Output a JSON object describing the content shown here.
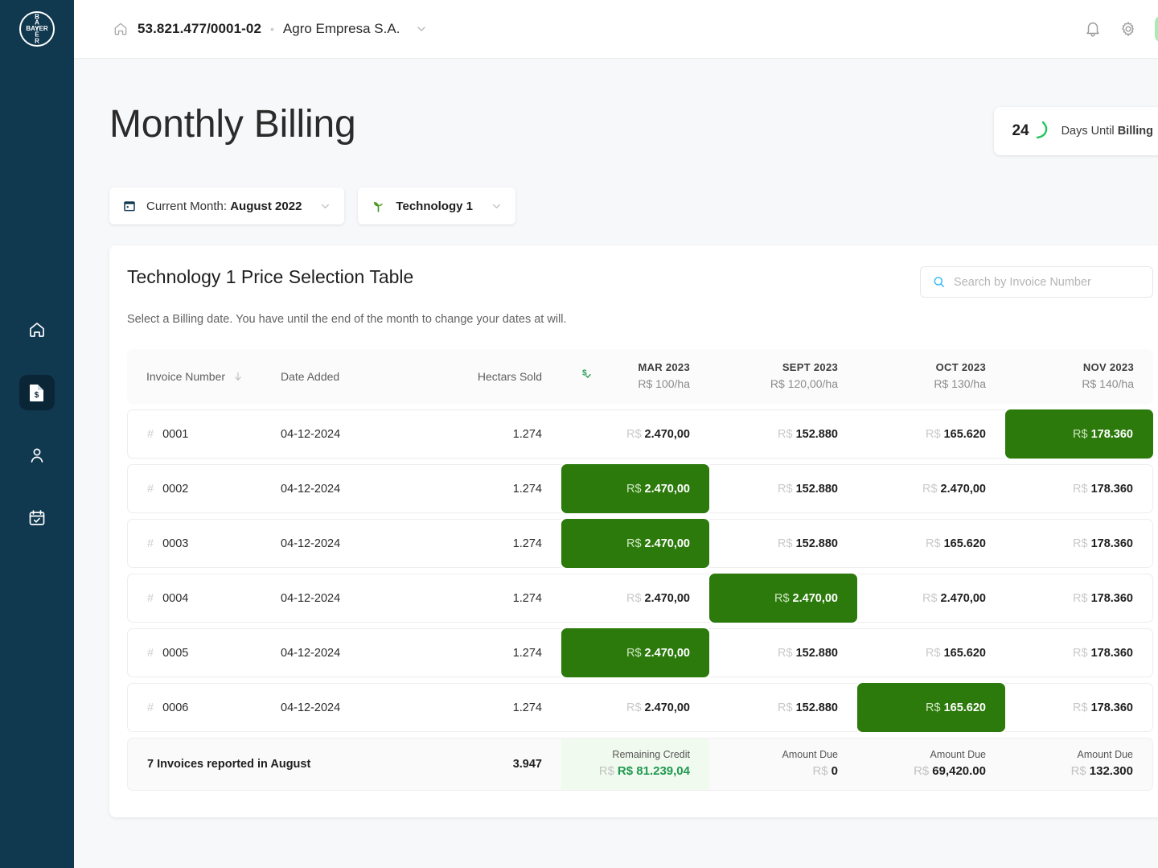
{
  "brand": {
    "logo_text": "BAYER",
    "sidebar_bg": "#10384f",
    "accent_green": "#2b7a0b",
    "light_green": "#f1faee"
  },
  "sidebar": {
    "items": [
      {
        "name": "home",
        "icon": "home-icon",
        "active": false
      },
      {
        "name": "billing",
        "icon": "invoice-dollar-icon",
        "active": true
      },
      {
        "name": "profile",
        "icon": "user-icon",
        "active": false
      },
      {
        "name": "calendar",
        "icon": "calendar-check-icon",
        "active": false
      }
    ]
  },
  "topbar": {
    "home_icon": "home-icon",
    "cnpj": "53.821.477/0001-02",
    "separator": "•",
    "company": "Agro Empresa S.A.",
    "chevron": "chevron-down-icon",
    "notifications_icon": "bell-icon",
    "settings_icon": "gear-icon",
    "avatar_label": "avatar"
  },
  "page": {
    "title": "Monthly Billing",
    "billing_badge": {
      "days": "24",
      "prefix": "Days Until ",
      "bold": "Billing"
    }
  },
  "filters": [
    {
      "icon": "calendar-icon",
      "prefix": "Current Month: ",
      "value": "August 2022",
      "chevron": "chevron-down-icon"
    },
    {
      "icon": "sprout-icon",
      "prefix": "",
      "value": "Technology 1",
      "chevron": "chevron-down-icon"
    }
  ],
  "card": {
    "title": "Technology 1 Price Selection Table",
    "subtitle": "Select a Billing date. You have until the end of the month to change your dates at will.",
    "search": {
      "placeholder": "Search by Invoice Number",
      "value": "",
      "icon": "search-icon"
    }
  },
  "table": {
    "headers": {
      "invoice": "Invoice Number",
      "sort_icon": "arrow-down-icon",
      "date": "Date Added",
      "hectars": "Hectars Sold",
      "dollar_check_icon": "dollar-check-icon"
    },
    "months": [
      {
        "label": "MAR 2023",
        "price": "R$ 100",
        "unit": "/ha",
        "highlight": true
      },
      {
        "label": "SEPT 2023",
        "price": "R$ 120,00",
        "unit": "/ha",
        "highlight": false
      },
      {
        "label": "OCT 2023",
        "price": "R$ 130",
        "unit": "/ha",
        "highlight": false
      },
      {
        "label": "NOV 2023",
        "price": "R$ 140",
        "unit": "/ha",
        "highlight": false
      }
    ],
    "hash": "#",
    "currency": "R$",
    "rows": [
      {
        "invoice": "0001",
        "date": "04-12-2024",
        "hectars": "1.274",
        "values": [
          "2.470,00",
          "152.880",
          "165.620",
          "178.360"
        ],
        "selected": 3
      },
      {
        "invoice": "0002",
        "date": "04-12-2024",
        "hectars": "1.274",
        "values": [
          "2.470,00",
          "152.880",
          "2.470,00",
          "178.360"
        ],
        "selected": 0
      },
      {
        "invoice": "0003",
        "date": "04-12-2024",
        "hectars": "1.274",
        "values": [
          "2.470,00",
          "152.880",
          "165.620",
          "178.360"
        ],
        "selected": 0
      },
      {
        "invoice": "0004",
        "date": "04-12-2024",
        "hectars": "1.274",
        "values": [
          "2.470,00",
          "2.470,00",
          "2.470,00",
          "178.360"
        ],
        "selected": 1
      },
      {
        "invoice": "0005",
        "date": "04-12-2024",
        "hectars": "1.274",
        "values": [
          "2.470,00",
          "152.880",
          "165.620",
          "178.360"
        ],
        "selected": 0
      },
      {
        "invoice": "0006",
        "date": "04-12-2024",
        "hectars": "1.274",
        "values": [
          "2.470,00",
          "152.880",
          "165.620",
          "178.360"
        ],
        "selected": 2
      }
    ],
    "footer": {
      "summary": "7 Invoices reported in August",
      "hectars_total": "3.947",
      "cells": [
        {
          "caption": "Remaining Credit",
          "currency": "R$",
          "amount": "R$ 81.239,04",
          "credit": true
        },
        {
          "caption": "Amount Due",
          "currency": "R$",
          "amount": "0",
          "credit": false
        },
        {
          "caption": "Amount Due",
          "currency": "R$",
          "amount": "69,420.00",
          "credit": false
        },
        {
          "caption": "Amount Due",
          "currency": "R$",
          "amount": "132.300",
          "credit": false
        }
      ]
    }
  }
}
